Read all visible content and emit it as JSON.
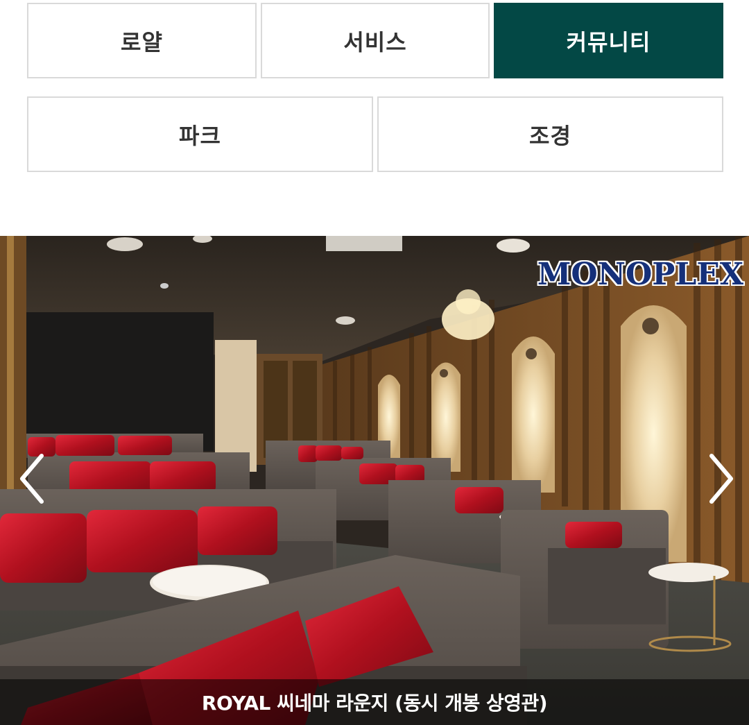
{
  "tabs": [
    {
      "label": "로얄",
      "active": false
    },
    {
      "label": "서비스",
      "active": false
    },
    {
      "label": "커뮤니티",
      "active": true
    },
    {
      "label": "파크",
      "active": false
    },
    {
      "label": "조경",
      "active": false
    }
  ],
  "slider": {
    "brand": "MONOPLEX",
    "caption": "ROYAL 씨네마 라운지 (동시 개봉 상영관)",
    "prev_icon": "chevron-left-icon",
    "next_icon": "chevron-right-icon"
  },
  "colors": {
    "active_tab": "#034845",
    "tab_border": "#d9d9d9",
    "brand": "#15307a"
  }
}
